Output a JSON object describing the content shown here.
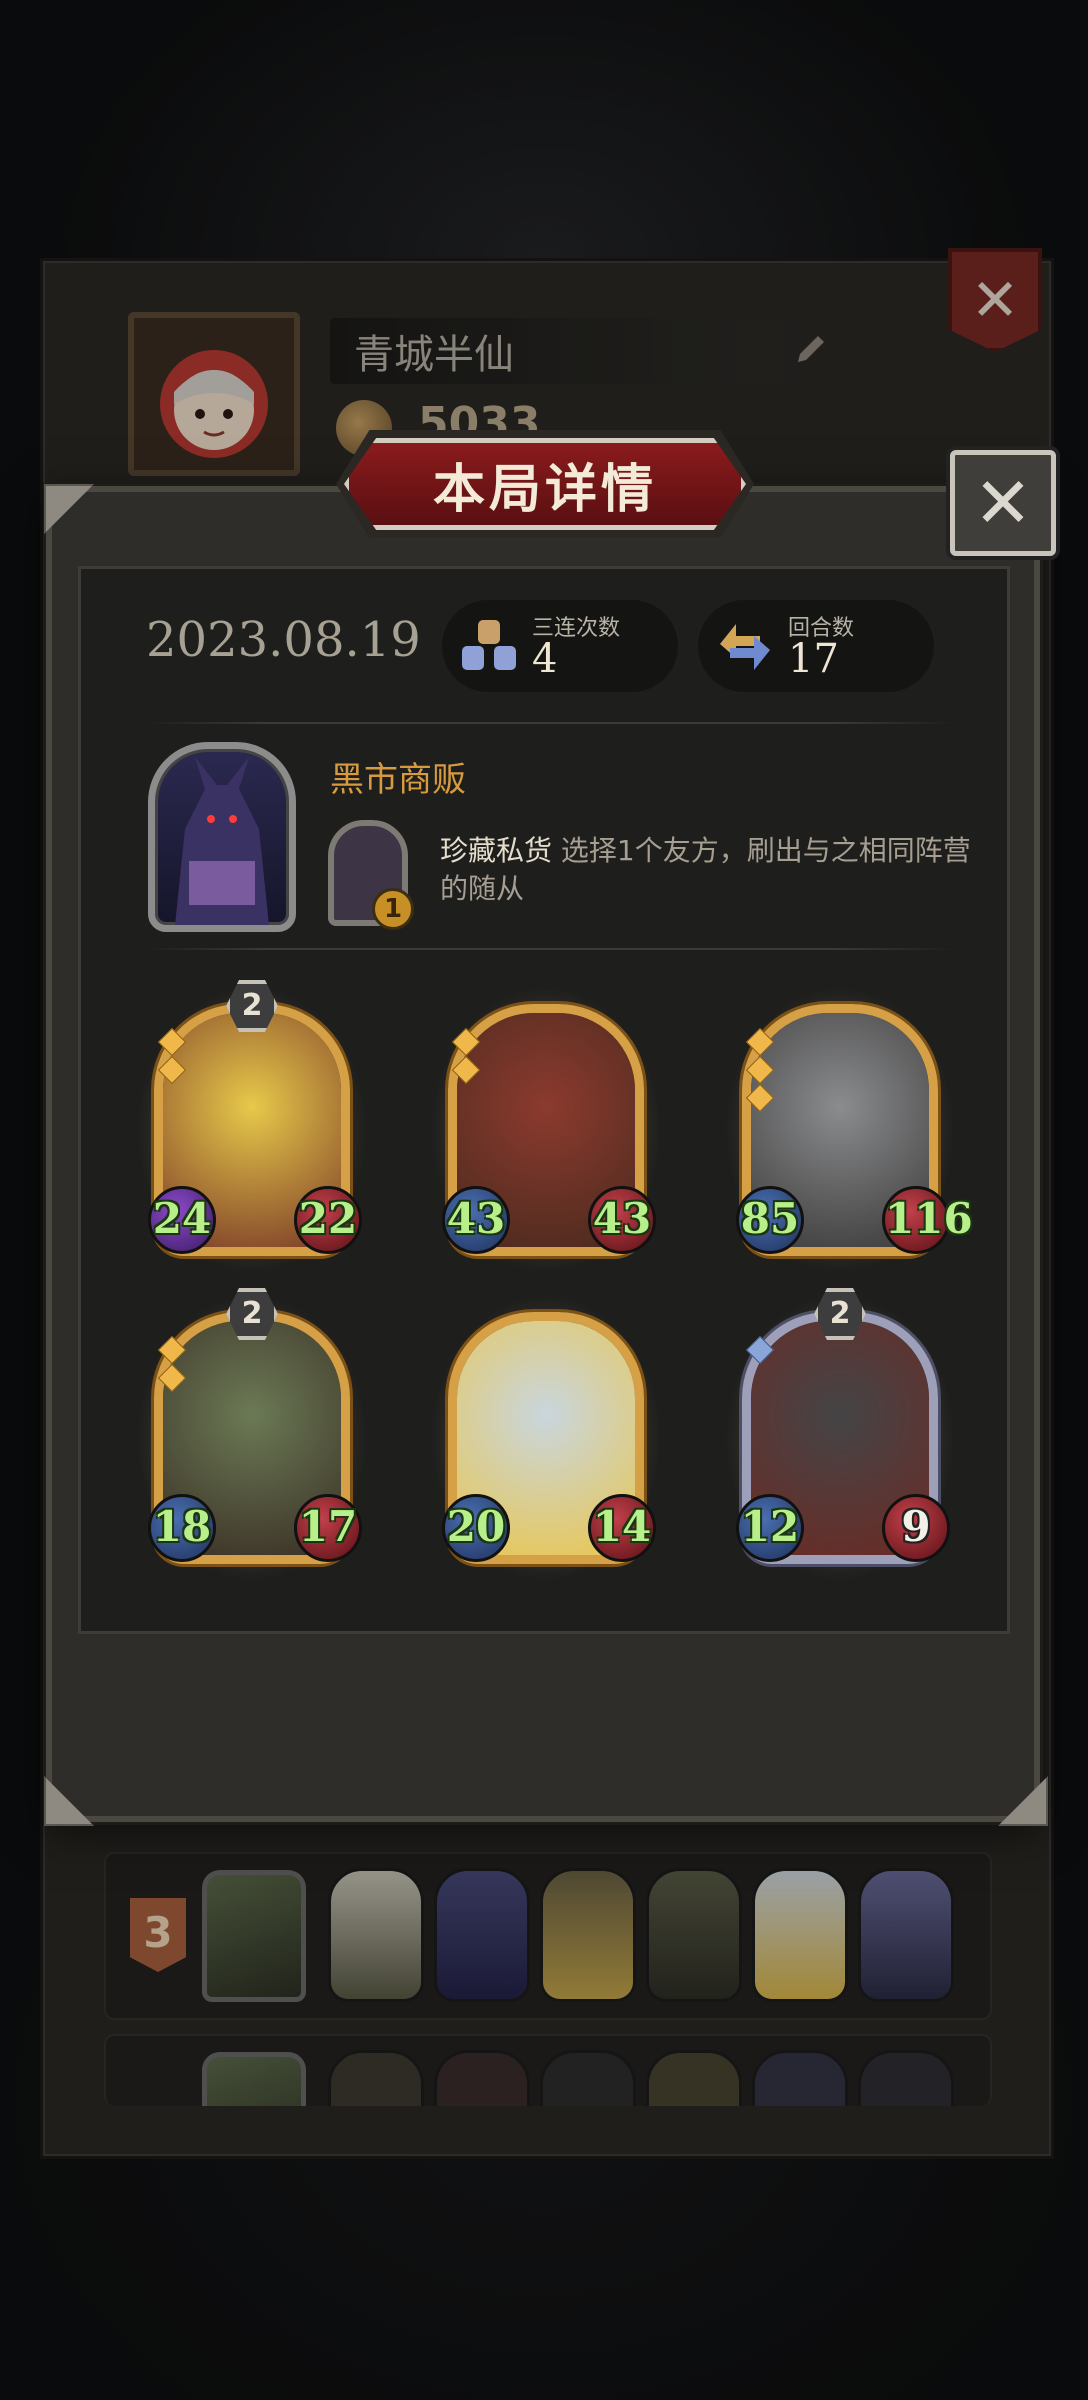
{
  "profile": {
    "name": "青城半仙",
    "coins": "5033"
  },
  "dialog": {
    "title": "本局详情",
    "close_symbol": "✕",
    "date": "2023.08.19",
    "stats": [
      {
        "label": "三连次数",
        "value": "4"
      },
      {
        "label": "回合数",
        "value": "17"
      }
    ],
    "hero": {
      "name": "黑市商贩",
      "power_name": "珍藏私货",
      "power_desc": " 选择1个友方，刷出与之相同阵营的随从",
      "power_cost": "1"
    },
    "minions": [
      {
        "name": "burning-brute",
        "tier": "2",
        "attack": "24",
        "health": "22",
        "gems": 2,
        "frame": "gold",
        "colors": [
          "#e7c94a",
          "#7a3a27"
        ]
      },
      {
        "name": "boar-chief",
        "tier": "",
        "attack": "43",
        "health": "43",
        "gems": 2,
        "frame": "gold",
        "colors": [
          "#8c3a2e",
          "#4a2a1e"
        ]
      },
      {
        "name": "knight",
        "tier": "",
        "attack": "85",
        "health": "116",
        "gems": 3,
        "frame": "gold",
        "colors": [
          "#8a8c8e",
          "#3c3a3a"
        ]
      },
      {
        "name": "red-haired-brawler",
        "tier": "2",
        "attack": "18",
        "health": "17",
        "gems": 2,
        "frame": "gold",
        "colors": [
          "#6b7a55",
          "#3a2f25"
        ]
      },
      {
        "name": "shield-bearer",
        "tier": "",
        "attack": "20",
        "health": "14",
        "gems": 0,
        "frame": "gold",
        "colors": [
          "#c9d6de",
          "#e9c64f"
        ]
      },
      {
        "name": "dark-shieldman",
        "tier": "2",
        "attack": "12",
        "health": "9",
        "gems": 1,
        "frame": "silver",
        "colors": [
          "#444446",
          "#6b2b25"
        ]
      }
    ]
  },
  "lineup": {
    "rank": "3"
  }
}
